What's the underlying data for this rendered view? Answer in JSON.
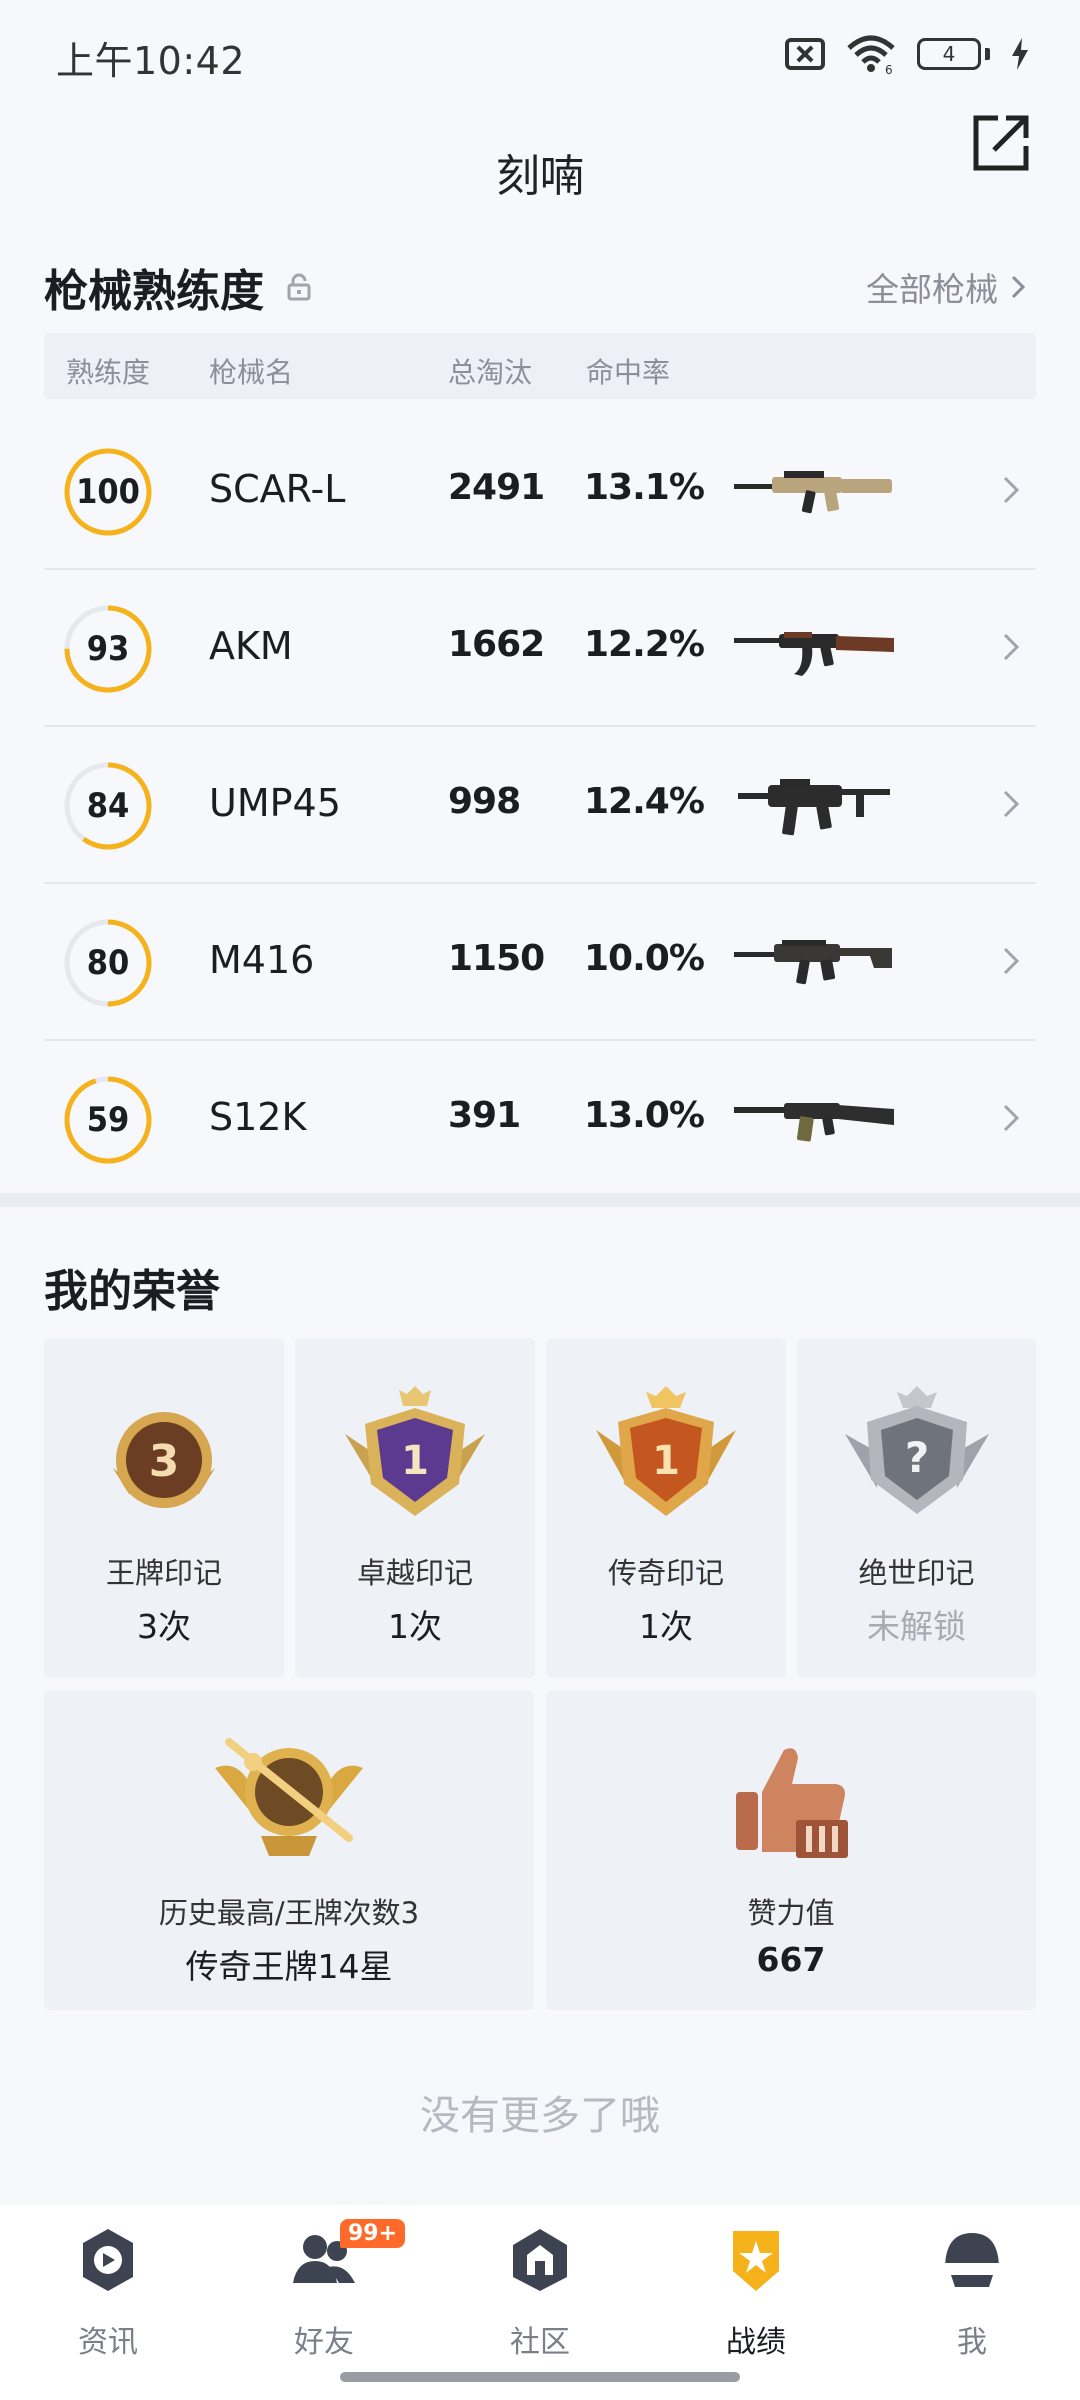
{
  "status_bar": {
    "time": "上午10:42",
    "wifi_label": "6",
    "battery": "4"
  },
  "header": {
    "title": "刻喃"
  },
  "mastery": {
    "title": "枪械熟练度",
    "all_link": "全部枪械",
    "columns": {
      "mastery": "熟练度",
      "name": "枪械名",
      "kills": "总淘汰",
      "accuracy": "命中率"
    },
    "guns": [
      {
        "mastery": "100",
        "progress": 1.0,
        "name": "SCAR-L",
        "kills": "2491",
        "accuracy": "13.1%",
        "gun_color": "#b9a57d"
      },
      {
        "mastery": "93",
        "progress": 0.75,
        "name": "AKM",
        "kills": "1662",
        "accuracy": "12.2%",
        "gun_color": "#6d3a26"
      },
      {
        "mastery": "84",
        "progress": 0.6,
        "name": "UMP45",
        "kills": "998",
        "accuracy": "12.4%",
        "gun_color": "#2c2c2c"
      },
      {
        "mastery": "80",
        "progress": 0.5,
        "name": "M416",
        "kills": "1150",
        "accuracy": "10.0%",
        "gun_color": "#3a3834"
      },
      {
        "mastery": "59",
        "progress": 0.95,
        "name": "S12K",
        "kills": "391",
        "accuracy": "13.0%",
        "gun_color": "#2e2e2e"
      }
    ]
  },
  "honors": {
    "title": "我的荣誉",
    "cards": [
      {
        "label": "王牌印记",
        "value": "3次",
        "badge_text": "3"
      },
      {
        "label": "卓越印记",
        "value": "1次",
        "badge_text": "1"
      },
      {
        "label": "传奇印记",
        "value": "1次",
        "badge_text": "1"
      },
      {
        "label": "绝世印记",
        "value": "未解锁",
        "badge_text": "?"
      },
      {
        "label": "历史最高/王牌次数3",
        "value": "传奇王牌14星"
      },
      {
        "label": "赞力值",
        "value": "667"
      }
    ]
  },
  "footer_text": "没有更多了哦",
  "bottom_nav": {
    "items": [
      {
        "label": "资讯",
        "icon": "news-icon"
      },
      {
        "label": "好友",
        "icon": "friends-icon",
        "badge": "99+"
      },
      {
        "label": "社区",
        "icon": "community-icon"
      },
      {
        "label": "战绩",
        "icon": "stats-icon",
        "active": true
      },
      {
        "label": "我",
        "icon": "profile-icon"
      }
    ]
  },
  "colors": {
    "accent": "#f5b21b",
    "ring_bg": "#e6e8ed",
    "badge": "#ff6a2b"
  }
}
